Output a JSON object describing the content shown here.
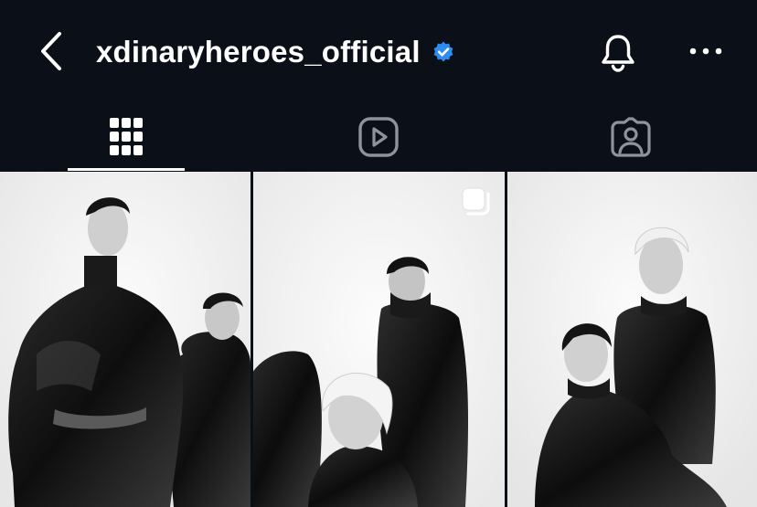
{
  "header": {
    "username": "xdinaryheroes_official",
    "verified": true,
    "verified_color": "#2d8cf0",
    "back_icon": "chevron-left-icon",
    "notification_icon": "bell-icon",
    "more_icon": "more-horizontal-icon"
  },
  "tabs": [
    {
      "name": "posts",
      "icon": "grid-icon",
      "selected": true
    },
    {
      "name": "reels",
      "icon": "reels-play-icon",
      "selected": false
    },
    {
      "name": "tagged",
      "icon": "tagged-person-icon",
      "selected": false
    }
  ],
  "posts": [
    {
      "index": 1,
      "multi": false
    },
    {
      "index": 2,
      "multi": true,
      "badge_icon": "carousel-icon"
    },
    {
      "index": 3,
      "multi": false
    }
  ],
  "colors": {
    "background": "#0b0f17",
    "foreground": "#ffffff",
    "photo_background": "#f1f1f1"
  }
}
